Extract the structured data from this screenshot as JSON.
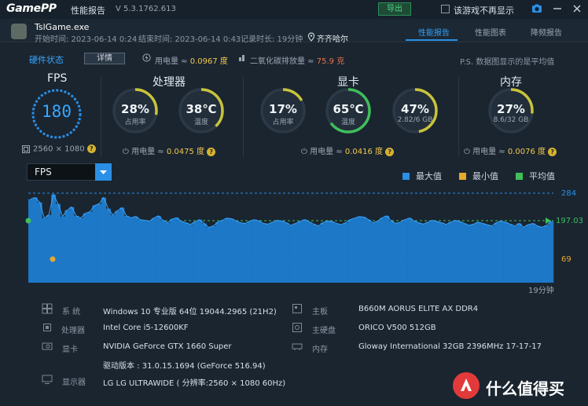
{
  "app": {
    "logo": "GamePP",
    "title": "性能报告",
    "version": "V 5.3.1762.613",
    "export_label": "导出",
    "no_show_label": "该游戏不再显示"
  },
  "session": {
    "game": "TslGame.exe",
    "start": "开始时间: 2023-06-14 0:24",
    "end": "结束时间: 2023-06-14 0:43",
    "duration": "记录时长: 19分钟",
    "city": "齐齐哈尔"
  },
  "tabs": [
    {
      "label": "性能报告",
      "active": true
    },
    {
      "label": "性能图表",
      "active": false
    },
    {
      "label": "降频报告",
      "active": false
    }
  ],
  "status": {
    "hw_label": "硬件状态",
    "detail_label": "详情",
    "power_prefix": "用电量 ≈ ",
    "power_value": "0.0967 度",
    "co2_prefix": "二氧化碳排放量 ≈ ",
    "co2_value": "75.9 克",
    "note": "P.S. 数据图显示的是平均值"
  },
  "fps": {
    "title": "FPS",
    "value": "180",
    "resolution": "2560 × 1080"
  },
  "cpu": {
    "title": "处理器",
    "usage": "28%",
    "usage_label": "占用率",
    "usage_fraction": 0.28,
    "temp": "38℃",
    "temp_label": "温度",
    "temp_fraction": 0.38,
    "power_prefix": "用电量 ≈ ",
    "power_value": "0.0475 度"
  },
  "gpu": {
    "title": "显卡",
    "usage": "17%",
    "usage_label": "占用率",
    "usage_fraction": 0.17,
    "temp": "65℃",
    "temp_label": "温度",
    "temp_fraction": 0.65,
    "vram": "47%",
    "vram_label": "2.82/6 GB",
    "vram_fraction": 0.47,
    "power_prefix": "用电量 ≈ ",
    "power_value": "0.0416 度"
  },
  "memory": {
    "title": "内存",
    "usage": "27%",
    "usage_label": "8.6/32 GB",
    "usage_fraction": 0.27,
    "power_prefix": "用电量 ≈ ",
    "power_value": "0.0076 度"
  },
  "chart_select": "FPS",
  "legend": [
    {
      "label": "最大值",
      "color": "#2b8fe6"
    },
    {
      "label": "最小值",
      "color": "#e6a92b"
    },
    {
      "label": "平均值",
      "color": "#3fbf5a"
    }
  ],
  "chart_data": {
    "type": "area",
    "title": "",
    "max_label": "284",
    "avg_label": "197.03",
    "min_label": "69",
    "duration_label": "19分钟",
    "ylim": [
      0,
      284
    ],
    "values": [
      265,
      270,
      255,
      205,
      215,
      280,
      250,
      210,
      230,
      240,
      212,
      205,
      220,
      225,
      245,
      250,
      270,
      235,
      215,
      228,
      238,
      212,
      206,
      210,
      200,
      198,
      195,
      205,
      212,
      198,
      190,
      202,
      206,
      195,
      190,
      185,
      193,
      200,
      188,
      175,
      180,
      192,
      198,
      205,
      203,
      196,
      190,
      188,
      195,
      200,
      196,
      188,
      186,
      192,
      198,
      196,
      190,
      182,
      188,
      194,
      200,
      193,
      186,
      180,
      190,
      196,
      194,
      188,
      184,
      190,
      200,
      205,
      210,
      208,
      200,
      190,
      195,
      206,
      212,
      196,
      188,
      192,
      200,
      205,
      196,
      190,
      186,
      192,
      198,
      194,
      190,
      185,
      192,
      198,
      194,
      188,
      182,
      186,
      192,
      188,
      184,
      180,
      190,
      196,
      192,
      186,
      180,
      188,
      176,
      184,
      188,
      180,
      176,
      182,
      195
    ]
  },
  "system": {
    "os_label": "系 统",
    "os_value": "Windows 10 专业版 64位 19044.2965 (21H2)",
    "cpu_label": "处理器",
    "cpu_value": "Intel Core i5-12600KF",
    "gpu_label": "显卡",
    "gpu_value": "NVIDIA GeForce GTX 1660 Super",
    "driver_value": "驱动版本 : 31.0.15.1694 (GeForce 516.94)",
    "monitor_label": "显示器",
    "monitor_value": "LG LG ULTRAWIDE ( 分辨率:2560 × 1080 60Hz)",
    "board_label": "主板",
    "board_value": "B660M AORUS ELITE AX DDR4",
    "disk_label": "主硬盘",
    "disk_value": "ORICO V500 512GB",
    "ram_label": "内存",
    "ram_value": "Gloway International 32GB 2396MHz 17-17-17-39"
  },
  "watermark": "什么值得买",
  "colors": {
    "accent": "#2b8fe6",
    "gauge_track": "#2c3946",
    "gauge_warm": "#c9c33a",
    "gauge_green": "#3fbf5a",
    "min": "#e6a92b"
  }
}
